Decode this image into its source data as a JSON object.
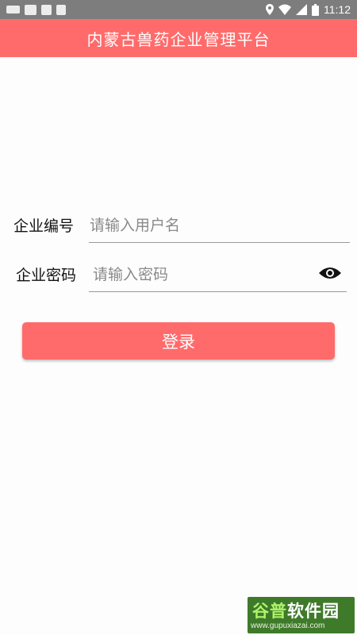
{
  "status_bar": {
    "time": "11:12",
    "left_icons": [
      "keyboard-icon",
      "mail-icon",
      "square-icon",
      "image-icon"
    ],
    "right_icons": [
      "location-icon",
      "wifi-icon",
      "signal-icon",
      "battery-icon"
    ]
  },
  "app_bar": {
    "title": "内蒙古兽药企业管理平台",
    "color": "#ff6b6b"
  },
  "form": {
    "username": {
      "label": "企业编号",
      "placeholder": "请输入用户名",
      "value": ""
    },
    "password": {
      "label": "企业密码",
      "placeholder": "请输入密码",
      "value": "",
      "toggle_icon": "eye-icon"
    }
  },
  "login_button": {
    "label": "登录",
    "color": "#ff6b6b"
  },
  "watermark": {
    "title_part1": "谷普",
    "title_part2": "软件园",
    "url": "www.gupuxiazai.com"
  }
}
